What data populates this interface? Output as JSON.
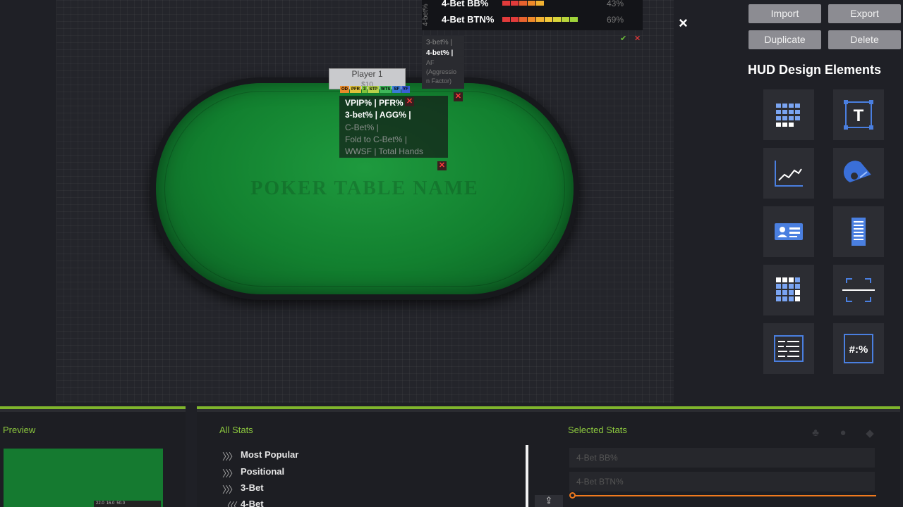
{
  "table": {
    "name": "POKER TABLE NAME"
  },
  "player": {
    "name": "Player 1",
    "stack": "$10"
  },
  "badges": [
    {
      "label": "ОD",
      "color": "#e88b2a"
    },
    {
      "label": "PFR",
      "color": "#e0c23a"
    },
    {
      "label": "3",
      "color": "#7fc43a"
    },
    {
      "label": "STP",
      "color": "#b6d34a"
    },
    {
      "label": "WTS",
      "color": "#3fb85a"
    },
    {
      "label": "SF",
      "color": "#3a7bd5"
    },
    {
      "label": "YF",
      "color": "#3a5fd5"
    }
  ],
  "hud_rows": [
    {
      "text": "VPIP% |   PFR%",
      "dim": false
    },
    {
      "text": "3-bet% |   AGG% |",
      "dim": false
    },
    {
      "text": "C-Bet% |",
      "dim": true
    },
    {
      "text": "Fold to C-Bet% |",
      "dim": true
    },
    {
      "text": "WWSF |   Total Hands",
      "dim": true
    }
  ],
  "popup": {
    "vertical_label": "4-bet%",
    "rows": [
      {
        "label": "4-Bet BB%",
        "pct": "43%",
        "filled": 5,
        "colors": [
          "#e23b3b",
          "#e23b3b",
          "#e8632e",
          "#ef8a2a",
          "#f2b232"
        ]
      },
      {
        "label": "4-Bet BTN%",
        "pct": "69%",
        "filled": 9,
        "colors": [
          "#e23b3b",
          "#e23b3b",
          "#e8632e",
          "#ef8a2a",
          "#f2b232",
          "#f2c93a",
          "#d9d53a",
          "#b8d43a",
          "#9fd43a"
        ]
      }
    ]
  },
  "stat_popup": {
    "line1": "3-bet% |",
    "line2": "4-bet% |",
    "line3": "AF",
    "line4": "(Aggressio",
    "line5": "n Factor)"
  },
  "buttons": {
    "import": "Import",
    "export": "Export",
    "duplicate": "Duplicate",
    "delete": "Delete",
    "close": "×"
  },
  "hud_design": {
    "title": "HUD Design Elements",
    "tiles": [
      "grid-stat-icon",
      "text-label-icon",
      "line-graph-icon",
      "gauge-icon",
      "player-card-icon",
      "document-list-icon",
      "heatmap-grid-icon",
      "divider-frame-icon",
      "list-panel-icon",
      "number-format-icon"
    ],
    "tile_texts": {
      "text": "T",
      "format": "#:%"
    }
  },
  "bottom": {
    "preview_label": "Preview",
    "all_stats_label": "All Stats",
    "selected_stats_label": "Selected Stats",
    "preview_strip": [
      "22.0",
      "16.0",
      "50.0"
    ],
    "categories": [
      {
        "arrows": "〉〉〉",
        "label": "Most Popular"
      },
      {
        "arrows": "〉〉〉",
        "label": "Positional"
      },
      {
        "arrows": "〉〉〉",
        "label": "3-Bet"
      },
      {
        "arrows": "〈〈〈",
        "label": "4-Bet"
      }
    ],
    "selected": [
      "4-Bet BB%",
      "4-Bet BTN%"
    ]
  },
  "colors": {
    "accent": "#7fb52c",
    "felt": "#12802f",
    "slider": "#f07a1e"
  }
}
